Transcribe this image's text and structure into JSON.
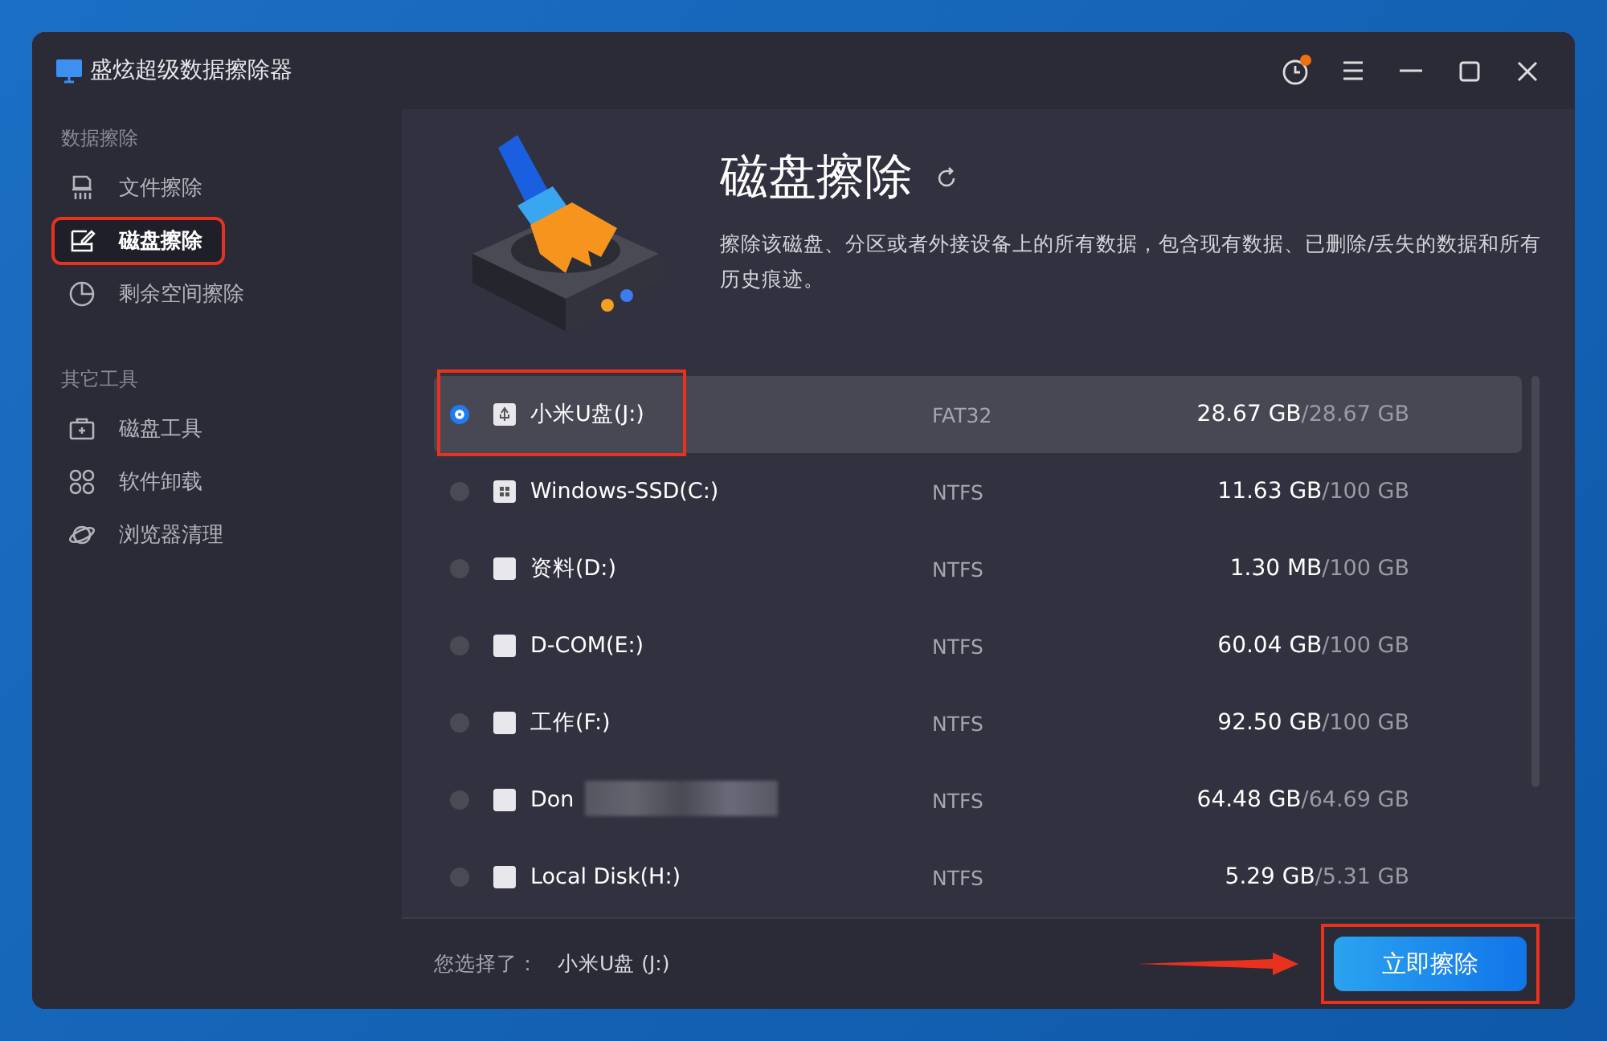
{
  "window": {
    "title": "盛炫超级数据擦除器",
    "notification": true
  },
  "sidebar": {
    "sections": [
      {
        "title": "数据擦除",
        "items": [
          {
            "label": "文件擦除",
            "kind": "file",
            "selected": false,
            "annotated": false
          },
          {
            "label": "磁盘擦除",
            "kind": "disk",
            "selected": true,
            "annotated": true
          },
          {
            "label": "剩余空间擦除",
            "kind": "pie",
            "selected": false,
            "annotated": false
          }
        ]
      },
      {
        "title": "其它工具",
        "items": [
          {
            "label": "磁盘工具",
            "kind": "toolbox",
            "selected": false,
            "annotated": false
          },
          {
            "label": "软件卸载",
            "kind": "apps",
            "selected": false,
            "annotated": false
          },
          {
            "label": "浏览器清理",
            "kind": "planet",
            "selected": false,
            "annotated": false
          }
        ]
      }
    ]
  },
  "header": {
    "title": "磁盘擦除",
    "description": "擦除该磁盘、分区或者外接设备上的所有数据，包含现有数据、已删除/丢失的数据和所有历史痕迹。"
  },
  "drives": [
    {
      "name": "小米U盘(J:)",
      "kind": "usb",
      "fs": "FAT32",
      "used": "28.67 GB",
      "total": "/28.67 GB",
      "selected": true,
      "annotated": true,
      "redacted": false
    },
    {
      "name": "Windows-SSD(C:)",
      "kind": "windows",
      "fs": "NTFS",
      "used": "11.63 GB",
      "total": "/100 GB",
      "selected": false,
      "annotated": false,
      "redacted": false
    },
    {
      "name": "资料(D:)",
      "kind": "plain",
      "fs": "NTFS",
      "used": "1.30 MB",
      "total": "/100 GB",
      "selected": false,
      "annotated": false,
      "redacted": false
    },
    {
      "name": "D-COM(E:)",
      "kind": "plain",
      "fs": "NTFS",
      "used": "60.04 GB",
      "total": "/100 GB",
      "selected": false,
      "annotated": false,
      "redacted": false
    },
    {
      "name": "工作(F:)",
      "kind": "plain",
      "fs": "NTFS",
      "used": "92.50 GB",
      "total": "/100 GB",
      "selected": false,
      "annotated": false,
      "redacted": false
    },
    {
      "name": "Don",
      "kind": "plain",
      "fs": "NTFS",
      "used": "64.48 GB",
      "total": "/64.69 GB",
      "selected": false,
      "annotated": false,
      "redacted": true
    },
    {
      "name": "Local Disk(H:)",
      "kind": "plain",
      "fs": "NTFS",
      "used": "5.29 GB",
      "total": "/5.31 GB",
      "selected": false,
      "annotated": false,
      "redacted": false
    }
  ],
  "footer": {
    "label": "您选择了：",
    "selection": "小米U盘 (J:)",
    "button": "立即擦除",
    "annotated": true
  }
}
